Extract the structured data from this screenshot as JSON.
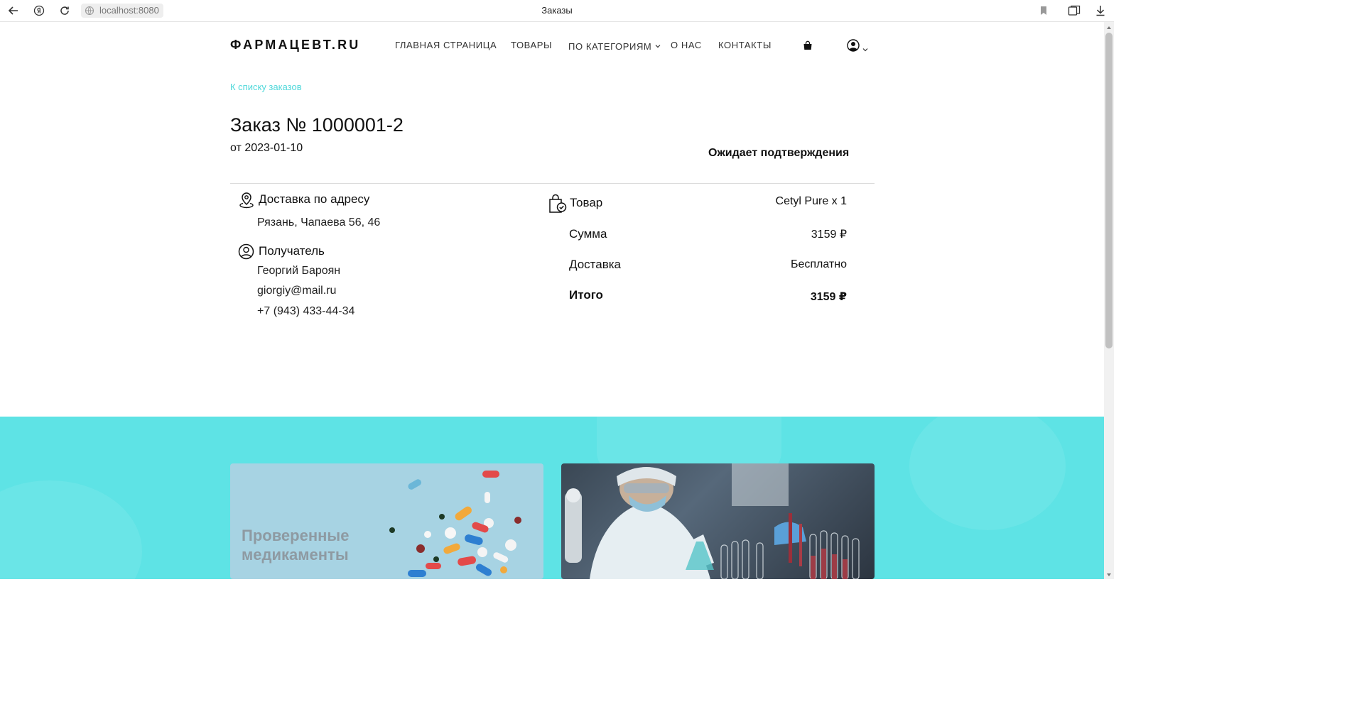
{
  "browser": {
    "url": "localhost:8080",
    "tab_title": "Заказы"
  },
  "header": {
    "logo": "ФАРМАЦЕВТ.RU",
    "nav": [
      {
        "label": "ГЛАВНАЯ СТРАНИЦА"
      },
      {
        "label": "ТОВАРЫ"
      },
      {
        "label": "ПО КАТЕГОРИЯМ"
      },
      {
        "label": "О НАС"
      },
      {
        "label": "КОНТАКТЫ"
      }
    ]
  },
  "back_link": "К списку заказов",
  "order": {
    "title": "Заказ № 1000001-2",
    "date": "от 2023-01-10",
    "status": "Ожидает подтверждения"
  },
  "delivery": {
    "label": "Доставка по адресу",
    "address": "Рязань, Чапаева 56, 46"
  },
  "recipient": {
    "label": "Получатель",
    "name": "Георгий Бароян",
    "email": "giorgiy@mail.ru",
    "phone": "+7 (943) 433-44-34"
  },
  "summary": {
    "product_label": "Товар",
    "product_value": "Cetyl Pure x 1",
    "sum_label": "Сумма",
    "sum_value": "3159 ₽",
    "delivery_label": "Доставка",
    "delivery_value": "Бесплатно",
    "total_label": "Итого",
    "total_value": "3159 ₽"
  },
  "banner": {
    "card1_title": "Проверенные медикаменты"
  },
  "colors": {
    "accent": "#4fd8da",
    "banner_bg": "#5ee3e5"
  }
}
